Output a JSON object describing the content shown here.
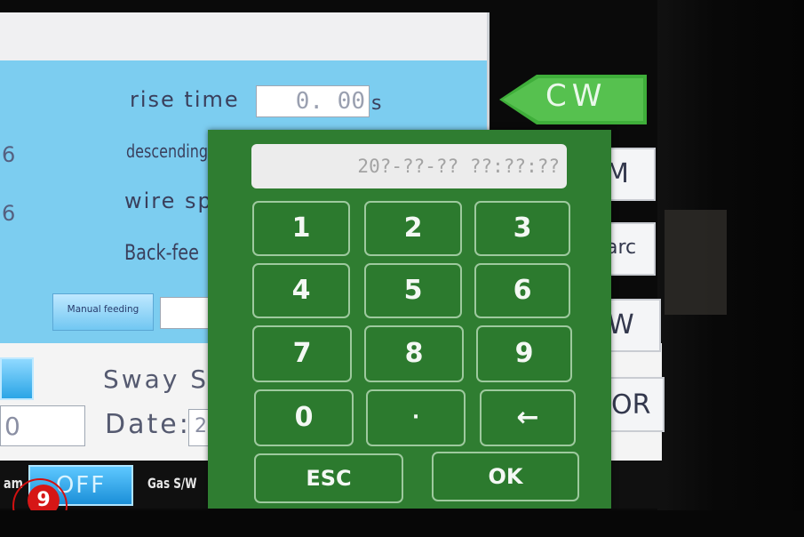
{
  "panel": {
    "rise_time_label": "rise time",
    "rise_time_value": "0. 00",
    "rise_time_unit": "s",
    "descending_label": "descending",
    "wire_speed_label": "wire sp",
    "backfeed_label": "Back-fee",
    "left_digit_1": "6",
    "left_digit_2": "6",
    "manual_feeding_label": "Manual feeding",
    "sway_label": "Sway S/",
    "date_label": "Date:",
    "date_value_partial": "2",
    "left_field_value": "0"
  },
  "side_buttons": {
    "cw_label": "CW",
    "btn_m": "M",
    "btn_arc": "arc",
    "btn_w": "W",
    "btn_or": "OR"
  },
  "status": {
    "left_partial": "am",
    "off_label": "OFF",
    "gas_label": "Gas S/W"
  },
  "keypad": {
    "display_text": "20?-??-?? ??:??:??",
    "keys": [
      "1",
      "2",
      "3",
      "4",
      "5",
      "6",
      "7",
      "8",
      "9",
      "0",
      "·",
      "←"
    ],
    "esc_label": "ESC",
    "ok_label": "OK"
  },
  "badge": {
    "number": "9"
  },
  "colors": {
    "keypad_bg": "#2f7d31",
    "panel_blue": "#7ccdf0",
    "cw_green": "#3fae3a",
    "badge_red": "#d61616"
  }
}
